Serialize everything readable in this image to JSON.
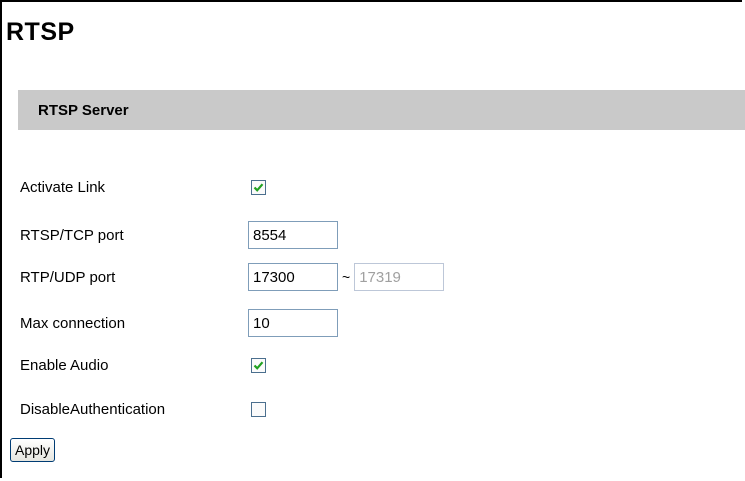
{
  "page": {
    "title": "RTSP"
  },
  "section": {
    "title": "RTSP Server"
  },
  "form": {
    "activate_link": {
      "label": "Activate Link",
      "checked": true
    },
    "rtsp_tcp_port": {
      "label": "RTSP/TCP port",
      "value": "8554"
    },
    "rtp_udp_port": {
      "label": "RTP/UDP port",
      "value": "17300",
      "separator": "~",
      "end_value": "17319"
    },
    "max_connection": {
      "label": "Max connection",
      "value": "10"
    },
    "enable_audio": {
      "label": "Enable Audio",
      "checked": true
    },
    "disable_authentication": {
      "label": "DisableAuthentication",
      "checked": false
    }
  },
  "actions": {
    "apply_label": "Apply"
  },
  "colors": {
    "checkmark": "#21a121",
    "section_bg": "#c9c9c9",
    "input_border": "#7f9db9"
  }
}
